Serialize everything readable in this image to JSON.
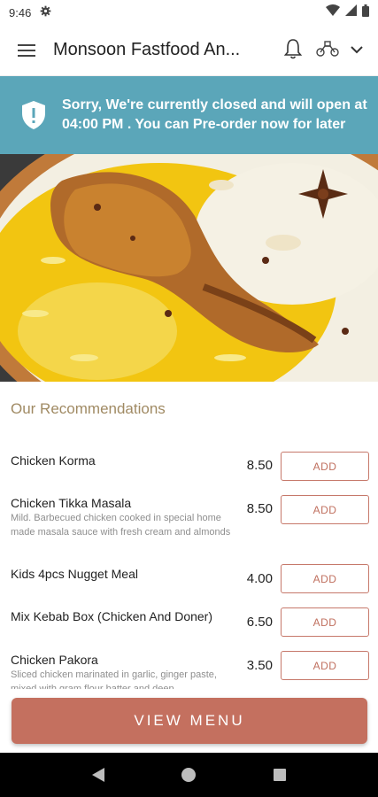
{
  "status_bar": {
    "time": "9:46",
    "icons": [
      "gear-icon",
      "wifi-icon",
      "signal-icon",
      "battery-icon"
    ]
  },
  "app_bar": {
    "title": "Monsoon Fastfood An...",
    "icons": [
      "menu-icon",
      "bell-icon",
      "delivery-bike-icon",
      "chevron-down-icon"
    ]
  },
  "banner": {
    "message": "Sorry, We're currently closed and will open at 04:00 PM . You can Pre-order now for later",
    "icon": "shield-alert-icon",
    "color": "#5ba6b9"
  },
  "recommendations": {
    "heading": "Our Recommendations",
    "add_label": "ADD",
    "items": [
      {
        "name": "Chicken Korma",
        "description": "",
        "price": "8.50"
      },
      {
        "name": "Chicken Tikka Masala",
        "description": "Mild. Barbecued chicken cooked in special home made masala sauce with fresh cream and almonds",
        "price": "8.50"
      },
      {
        "name": "Kids 4pcs Nugget Meal",
        "description": "",
        "price": "4.00"
      },
      {
        "name": "Mix Kebab Box (Chicken And Doner)",
        "description": "",
        "price": "6.50"
      },
      {
        "name": "Chicken Pakora",
        "description": "Sliced chicken marinated in garlic, ginger paste, mixed with gram flour batter and deep",
        "price": "3.50"
      }
    ]
  },
  "footer": {
    "view_menu_label": "VIEW MENU",
    "accent_color": "#c4705f"
  },
  "nav_bar": {
    "icons": [
      "back-icon",
      "home-icon",
      "recents-icon"
    ]
  }
}
